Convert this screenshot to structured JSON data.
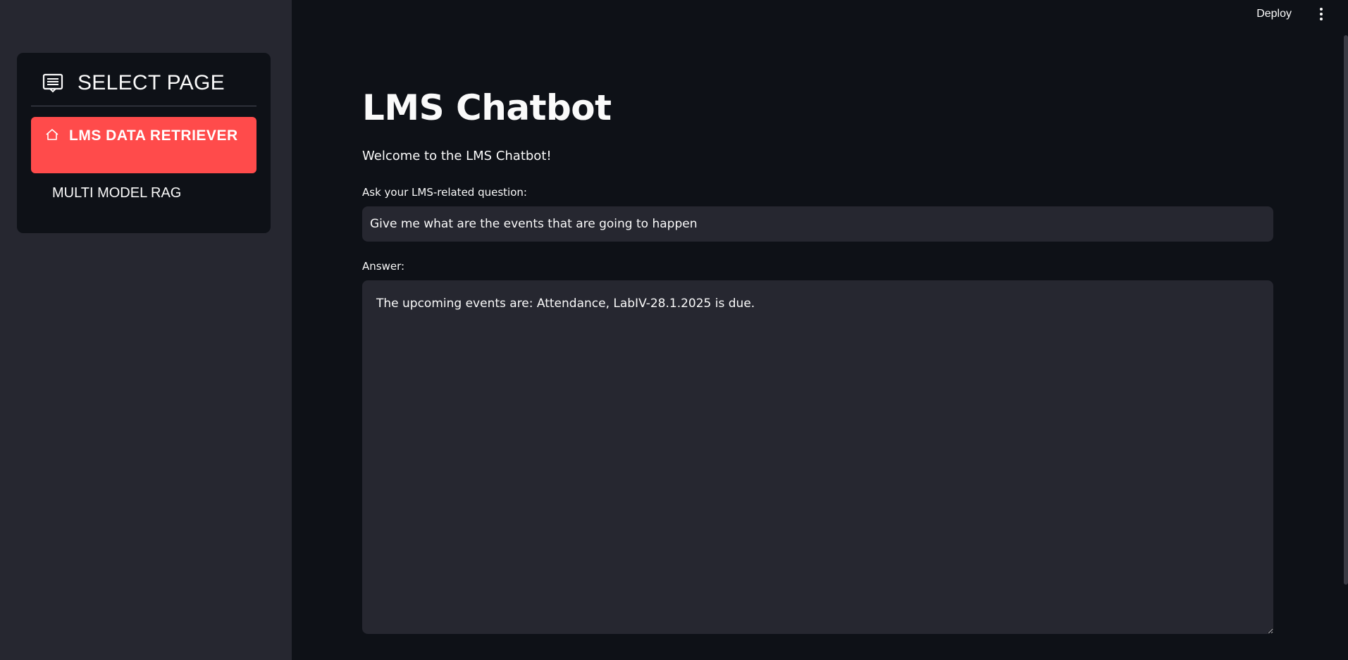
{
  "sidebar": {
    "title": "SELECT PAGE",
    "items": [
      {
        "label": "LMS DATA RETRIEVER",
        "icon": "home-icon",
        "active": true
      },
      {
        "label": "MULTI MODEL RAG",
        "active": false
      }
    ]
  },
  "header": {
    "deploy_label": "Deploy"
  },
  "main": {
    "title": "LMS Chatbot",
    "welcome": "Welcome to the LMS Chatbot!",
    "question_label": "Ask your LMS-related question:",
    "question_value": "Give me what are the events that are going to happen",
    "answer_label": "Answer:",
    "answer_value": "The upcoming events are: Attendance, LabIV-28.1.2025 is due."
  },
  "colors": {
    "accent": "#ff4b4b",
    "background": "#0e1117",
    "sidebar": "#262730"
  }
}
